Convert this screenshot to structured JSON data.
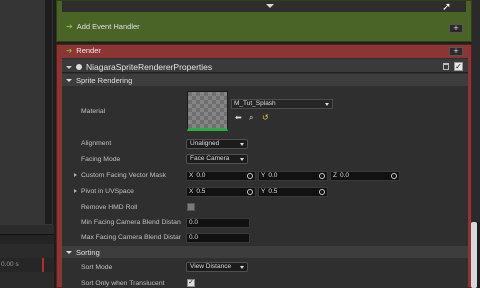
{
  "event_handler": {
    "label": "Add Event Handler"
  },
  "render": {
    "title": "Render",
    "module_title": "NiagaraSpriteRendererProperties",
    "sprite_rendering": {
      "section_label": "Sprite Rendering",
      "material_label": "Material",
      "material_value": "M_Tut_Splash",
      "alignment_label": "Alignment",
      "alignment_value": "Unaligned",
      "facing_mode_label": "Facing Mode",
      "facing_mode_value": "Face Camera",
      "custom_facing_label": "Custom Facing Vector Mask",
      "custom_facing": {
        "x_label": "X",
        "x": "0.0",
        "y_label": "Y",
        "y": "0.0",
        "z_label": "Z",
        "z": "0.0"
      },
      "pivot_label": "Pivot in UVSpace",
      "pivot": {
        "x_label": "X",
        "x": "0.5",
        "y_label": "Y",
        "y": "0.5"
      },
      "remove_hmd_label": "Remove HMD Roll",
      "remove_hmd_checked": false,
      "min_facing_label": "Min Facing Camera Blend Distan",
      "min_facing_value": "0.0",
      "max_facing_label": "Max Facing Camera Blend Distan",
      "max_facing_value": "0.0"
    },
    "sorting": {
      "section_label": "Sorting",
      "sort_mode_label": "Sort Mode",
      "sort_mode_value": "View Distance",
      "sort_translucent_label": "Sort Only when Translucent",
      "sort_translucent_checked": true
    }
  },
  "timeline": {
    "time_text": "0.00 s"
  },
  "colors": {
    "event_green": "#4a6327",
    "render_red": "#8b3535",
    "accent_green": "#7fc53b"
  },
  "icons": [
    "collapse-arrow-icon",
    "plus-icon",
    "module-icon",
    "trash-icon",
    "checkbox-icon",
    "use-selected-icon",
    "browse-icon",
    "reset-icon",
    "mouse-cursor-icon"
  ]
}
